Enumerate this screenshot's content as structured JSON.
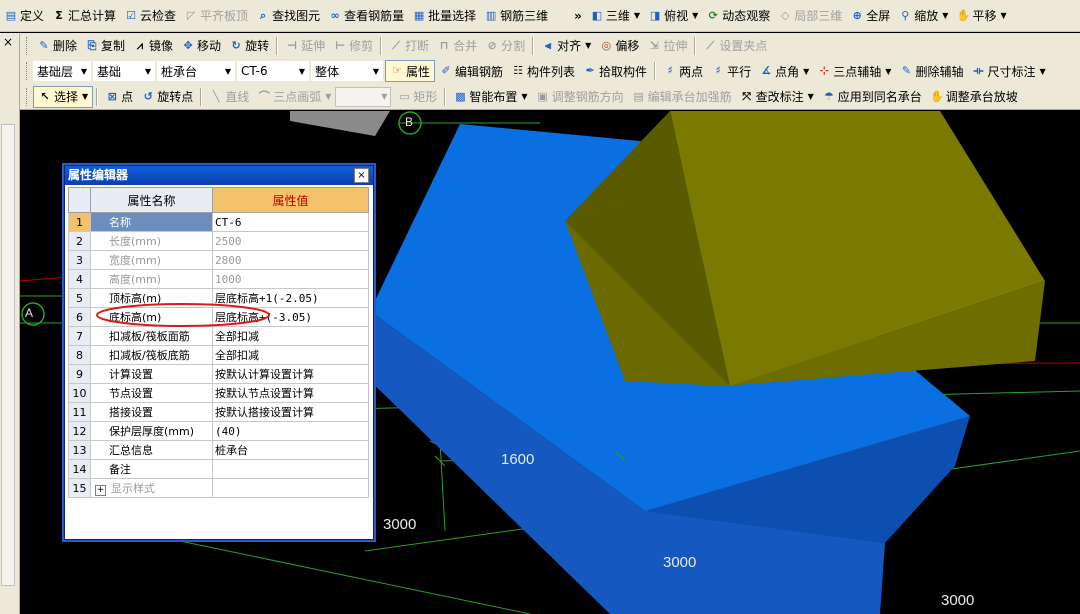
{
  "toolbar1": {
    "items": [
      {
        "label": "定义",
        "icon": "define-icon"
      },
      {
        "label": "汇总计算",
        "icon": "sigma-icon"
      },
      {
        "label": "云检查",
        "icon": "cloud-check-icon"
      },
      {
        "label": "平齐板顶",
        "icon": "flush-top-icon"
      },
      {
        "label": "查找图元",
        "icon": "find-icon"
      },
      {
        "label": "查看钢筋量",
        "icon": "rebar-view-icon"
      },
      {
        "label": "批量选择",
        "icon": "batch-select-icon"
      },
      {
        "label": "钢筋三维",
        "icon": "rebar-3d-icon"
      }
    ],
    "more": "»",
    "right": [
      {
        "label": "三维",
        "icon": "3d-icon"
      },
      {
        "label": "俯视",
        "icon": "top-view-icon"
      },
      {
        "label": "动态观察",
        "icon": "orbit-icon"
      },
      {
        "label": "局部三维",
        "icon": "local-3d-icon"
      },
      {
        "label": "全屏",
        "icon": "fullscreen-icon"
      },
      {
        "label": "缩放",
        "icon": "zoom-icon"
      },
      {
        "label": "平移",
        "icon": "pan-icon"
      }
    ]
  },
  "toolbar2": {
    "items": [
      {
        "label": "删除",
        "icon": "delete-icon"
      },
      {
        "label": "复制",
        "icon": "copy-icon"
      },
      {
        "label": "镜像",
        "icon": "mirror-icon"
      },
      {
        "label": "移动",
        "icon": "move-icon"
      },
      {
        "label": "旋转",
        "icon": "rotate-icon"
      },
      {
        "label": "延伸",
        "icon": "extend-icon"
      },
      {
        "label": "修剪",
        "icon": "trim-icon"
      },
      {
        "label": "打断",
        "icon": "break-icon"
      },
      {
        "label": "合并",
        "icon": "merge-icon"
      },
      {
        "label": "分割",
        "icon": "split-icon"
      },
      {
        "label": "对齐",
        "icon": "align-icon"
      },
      {
        "label": "偏移",
        "icon": "offset-icon"
      },
      {
        "label": "拉伸",
        "icon": "stretch-icon"
      },
      {
        "label": "设置夹点",
        "icon": "grip-point-icon"
      }
    ]
  },
  "toolbar3": {
    "combos": [
      "基础层",
      "基础",
      "桩承台",
      "CT-6",
      "整体"
    ],
    "items": [
      {
        "label": "属性",
        "icon": "properties-icon"
      },
      {
        "label": "编辑钢筋",
        "icon": "edit-rebar-icon"
      },
      {
        "label": "构件列表",
        "icon": "component-list-icon"
      },
      {
        "label": "拾取构件",
        "icon": "pick-icon"
      },
      {
        "label": "两点",
        "icon": "two-point-icon"
      },
      {
        "label": "平行",
        "icon": "parallel-icon"
      },
      {
        "label": "点角",
        "icon": "point-angle-icon"
      },
      {
        "label": "三点辅轴",
        "icon": "three-point-axis-icon"
      },
      {
        "label": "删除辅轴",
        "icon": "delete-axis-icon"
      },
      {
        "label": "尺寸标注",
        "icon": "dimension-icon"
      }
    ]
  },
  "toolbar4": {
    "items": [
      {
        "label": "选择",
        "icon": "select-icon"
      },
      {
        "label": "点",
        "icon": "point-icon"
      },
      {
        "label": "旋转点",
        "icon": "rotate-point-icon"
      },
      {
        "label": "直线",
        "icon": "line-icon"
      },
      {
        "label": "三点画弧",
        "icon": "arc-icon"
      },
      {
        "label": "矩形",
        "icon": "rectangle-icon"
      },
      {
        "label": "智能布置",
        "icon": "smart-layout-icon"
      },
      {
        "label": "调整钢筋方向",
        "icon": "adjust-rebar-icon"
      },
      {
        "label": "编辑承台加强筋",
        "icon": "edit-cap-rebar-icon"
      },
      {
        "label": "查改标注",
        "icon": "edit-label-icon"
      },
      {
        "label": "应用到同名承台",
        "icon": "apply-same-icon"
      },
      {
        "label": "调整承台放坡",
        "icon": "adjust-slope-icon"
      }
    ]
  },
  "left_panel": {
    "close": "×"
  },
  "viewport": {
    "axis_labels": [
      "A",
      "B"
    ],
    "dimensions": [
      "1600",
      "3000",
      "3000",
      "3000"
    ],
    "colors": {
      "base_top": "#0a6fe0",
      "base_front": "#1458c0",
      "base_side": "#0c48a0",
      "cap_top": "#7a7a00",
      "cap_left": "#5a5a00",
      "cap_front": "#6e6e00",
      "grid": "#2aa02a",
      "axis_red": "#c00000"
    }
  },
  "property_editor": {
    "title": "属性编辑器",
    "close": "×",
    "col_name": "属性名称",
    "col_value": "属性值",
    "rows": [
      {
        "no": "1",
        "name": "名称",
        "value": "CT-6"
      },
      {
        "no": "2",
        "name": "长度(mm)",
        "value": "2500"
      },
      {
        "no": "3",
        "name": "宽度(mm)",
        "value": "2800"
      },
      {
        "no": "4",
        "name": "高度(mm)",
        "value": "1000"
      },
      {
        "no": "5",
        "name": "顶标高(m)",
        "value": "层底标高+1(-2.05)"
      },
      {
        "no": "6",
        "name": "底标高(m)",
        "value": "层底标高+(-3.05)"
      },
      {
        "no": "7",
        "name": "扣减板/筏板面筋",
        "value": "全部扣减"
      },
      {
        "no": "8",
        "name": "扣减板/筏板底筋",
        "value": "全部扣减"
      },
      {
        "no": "9",
        "name": "计算设置",
        "value": "按默认计算设置计算"
      },
      {
        "no": "10",
        "name": "节点设置",
        "value": "按默认节点设置计算"
      },
      {
        "no": "11",
        "name": "搭接设置",
        "value": "按默认搭接设置计算"
      },
      {
        "no": "12",
        "name": "保护层厚度(mm)",
        "value": "(40)"
      },
      {
        "no": "13",
        "name": "汇总信息",
        "value": "桩承台"
      },
      {
        "no": "14",
        "name": "备注",
        "value": ""
      },
      {
        "no": "15",
        "name": "显示样式",
        "value": "",
        "expand": "+"
      }
    ]
  }
}
